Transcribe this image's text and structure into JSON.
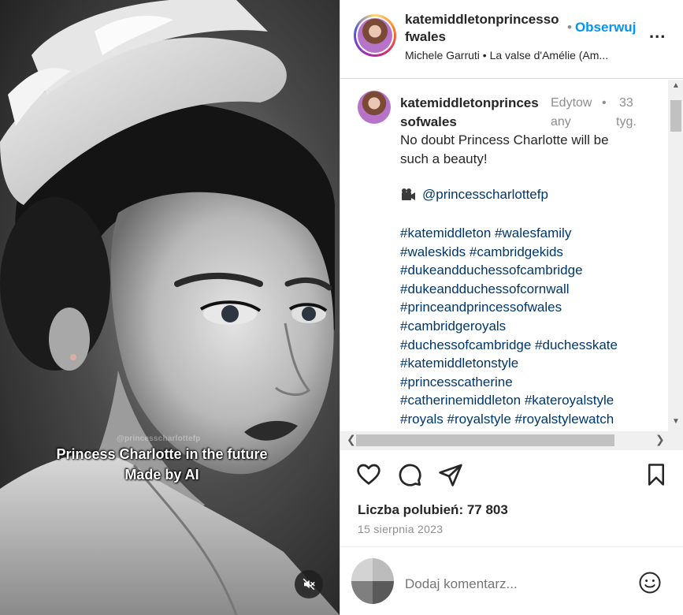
{
  "media": {
    "watermark": "@princesscharlottefp",
    "caption_line1": "Princess Charlotte in the future",
    "caption_line2": "Made by AI",
    "mute_icon": "speaker-muted-icon"
  },
  "header": {
    "username_line1": "katemiddletonprincesso",
    "username_line2": "fwales",
    "follow_separator": "•",
    "follow_label": "Obserwuj",
    "more_label": "...",
    "audio": "Michele Garruti • La valse d'Amélie (Am..."
  },
  "post_comment": {
    "username_line1": "katemiddletonprinces",
    "username_line2": "sofwales",
    "edited_line1": "Edytow",
    "edited_line2": "any",
    "dot": "•",
    "time_line1": "33",
    "time_line2": "tyg.",
    "text_line1": "No doubt Princess Charlotte will be",
    "text_line2": "such a beauty!",
    "mention_emoji": "film-camera-icon",
    "mention": "@princesscharlottefp",
    "hashtags": [
      "#katemiddleton #walesfamily",
      "#waleskids #cambridgekids",
      "#dukeandduchessofcambridge",
      "#dukeandduchessofcornwall",
      "#princeandprincessofwales",
      "#cambridgeroyals",
      "#duchessofcambridge #duchesskate",
      "#katemiddletonstyle",
      "#princesscatherine",
      "#catherinemiddleton #kateroyalstyle",
      "#royals #royalstyle #royalstylewatch"
    ]
  },
  "actions": {
    "like_icon": "heart-icon",
    "comment_icon": "comment-icon",
    "share_icon": "paper-plane-icon",
    "save_icon": "bookmark-icon"
  },
  "likes": "Liczba polubień: 77 803",
  "date": "15 sierpnia 2023",
  "add_comment": {
    "placeholder": "Dodaj komentarz...",
    "emoji_icon": "smiley-icon"
  },
  "colors": {
    "link_blue": "#0095f6",
    "hashtag_blue": "#00376b",
    "muted_gray": "#8e8e8e",
    "text": "#262626"
  }
}
